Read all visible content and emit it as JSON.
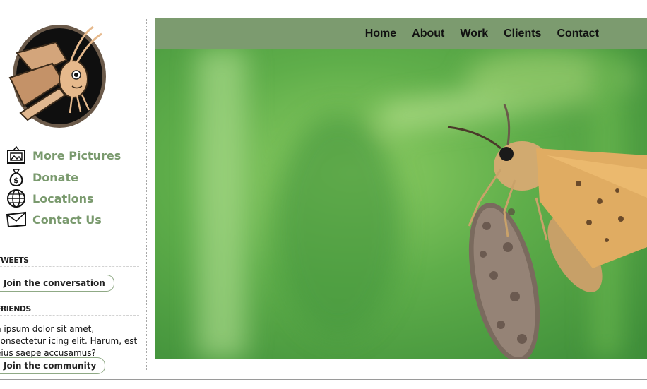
{
  "sidebar": {
    "logo_alt": "moth mascot logo",
    "nav": [
      {
        "label": "More Pictures",
        "icon": "picture-frame-icon"
      },
      {
        "label": "Donate",
        "icon": "money-bag-icon"
      },
      {
        "label": "Locations",
        "icon": "globe-icon"
      },
      {
        "label": "Contact Us",
        "icon": "envelope-icon"
      }
    ],
    "tweets": {
      "heading": "TWEETS",
      "button": "Join the conversation"
    },
    "friends": {
      "heading": "FRIENDS",
      "text": "n ipsum dolor sit amet, consectetur icing elit. Harum, est eius saepe accusamus?",
      "button": "Join the community"
    }
  },
  "header": {
    "nav": [
      "Home",
      "About",
      "Work",
      "Clients",
      "Contact"
    ]
  },
  "colors": {
    "accent": "#7c9b6f",
    "link": "#7a9a6e"
  }
}
